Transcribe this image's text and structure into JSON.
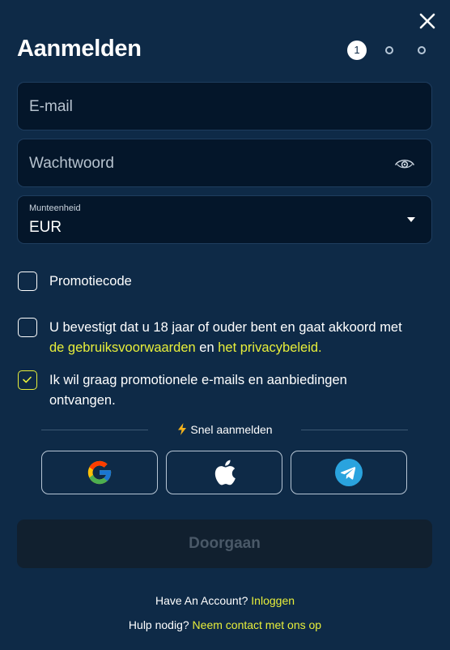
{
  "header": {
    "title": "Aanmelden",
    "close_icon": "close-icon",
    "steps": {
      "current": "1",
      "total": 3
    }
  },
  "form": {
    "email": {
      "placeholder": "E-mail",
      "value": ""
    },
    "password": {
      "placeholder": "Wachtwoord",
      "value": "",
      "toggle_icon": "eye-icon"
    },
    "currency": {
      "label": "Munteenheid",
      "selected": "EUR",
      "icon": "caret-down-icon"
    },
    "promo": {
      "label": "Promotiecode",
      "checked": false
    },
    "terms": {
      "checked": false,
      "text_before": "U bevestigt dat u 18 jaar of ouder bent en gaat akkoord met",
      "terms_link": "de gebruiksvoorwaarden",
      "joiner": " en ",
      "privacy_link": "het privacybeleid."
    },
    "newsletter": {
      "checked": true,
      "text": "Ik wil graag promotionele e-mails en aanbiedingen ontvangen."
    }
  },
  "quick_signup": {
    "label": "Snel aanmelden",
    "icon": "lightning-icon",
    "providers": [
      {
        "name": "Google",
        "icon": "google-icon"
      },
      {
        "name": "Apple",
        "icon": "apple-icon"
      },
      {
        "name": "Telegram",
        "icon": "telegram-icon"
      }
    ]
  },
  "submit": {
    "label": "Doorgaan",
    "enabled": false
  },
  "footer": {
    "account_prompt": "Have An Account?",
    "login_link": "Inloggen",
    "help_prompt": "Hulp nodig?",
    "contact_link": "Neem contact met ons op"
  },
  "colors": {
    "background": "#0e2a47",
    "field_bg": "#04162a",
    "accent": "#e8ef3a",
    "disabled_button": "#11202f",
    "disabled_text": "#4a5968"
  }
}
